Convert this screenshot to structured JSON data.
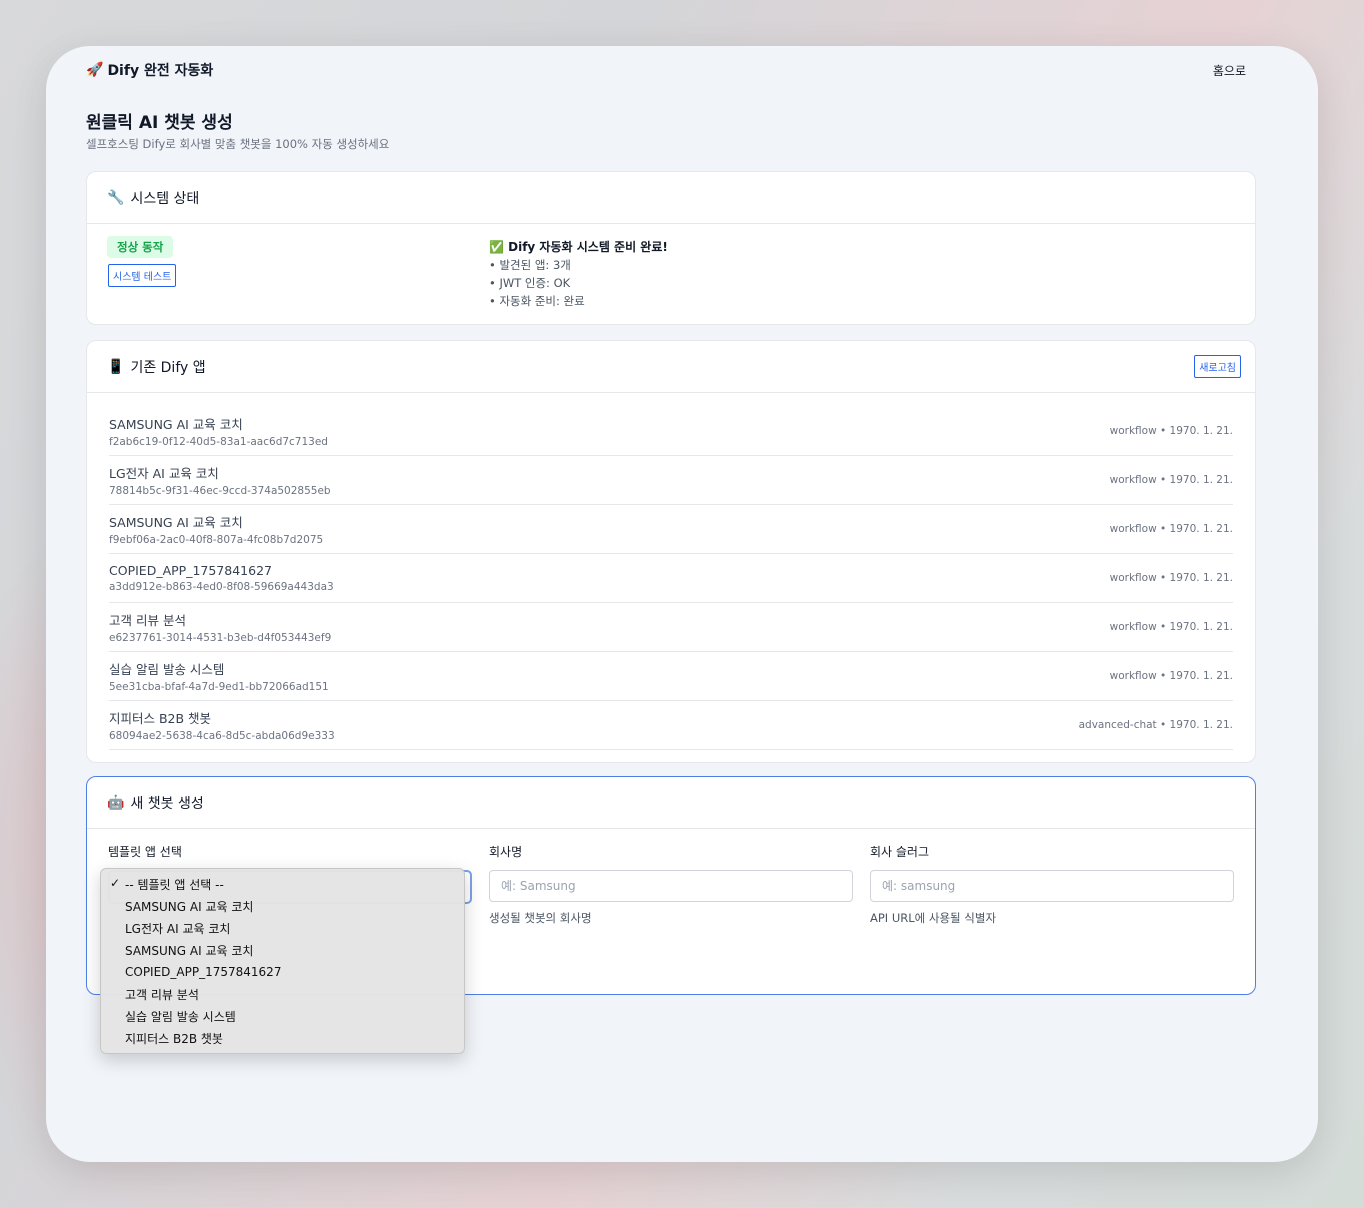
{
  "topbar": {
    "brand_icon": "rocket-icon",
    "brand": "Dify 완전 자동화",
    "home_link": "홈으로"
  },
  "header": {
    "title": "원클릭 AI 챗봇 생성",
    "subtitle": "셀프호스팅 Dify로 회사별 맞춤 챗봇을 100% 자동 생성하세요"
  },
  "system_status": {
    "title": "시스템 상태",
    "icon": "wrench-icon",
    "badge": "정상 동작",
    "test_button": "시스템 테스트",
    "message_lead": "Dify 자동화 시스템 준비 완료!",
    "lines": [
      "• 발견된 앱: 3개",
      "• JWT 인증: OK",
      "• 자동화 준비: 완료"
    ],
    "colors": {
      "ok_bg": "#dcfce7",
      "ok_text": "#16a34a",
      "accent": "#2563eb"
    }
  },
  "apps": {
    "title": "기존 Dify 앱",
    "icon": "phone-icon",
    "refresh_button": "새로고침",
    "items": [
      {
        "name": "SAMSUNG AI 교육 코치",
        "id": "f2ab6c19-0f12-40d5-83a1-aac6d7c713ed",
        "meta": "workflow • 1970. 1. 21."
      },
      {
        "name": "LG전자 AI 교육 코치",
        "id": "78814b5c-9f31-46ec-9ccd-374a502855eb",
        "meta": "workflow • 1970. 1. 21."
      },
      {
        "name": "SAMSUNG AI 교육 코치",
        "id": "f9ebf06a-2ac0-40f8-807a-4fc08b7d2075",
        "meta": "workflow • 1970. 1. 21."
      },
      {
        "name": "COPIED_APP_1757841627",
        "id": "a3dd912e-b863-4ed0-8f08-59669a443da3",
        "meta": "workflow • 1970. 1. 21."
      },
      {
        "name": "고객 리뷰 분석",
        "id": "e6237761-3014-4531-b3eb-d4f053443ef9",
        "meta": "workflow • 1970. 1. 21."
      },
      {
        "name": "실습 알림 발송 시스템",
        "id": "5ee31cba-bfaf-4a7d-9ed1-bb72066ad151",
        "meta": "workflow • 1970. 1. 21."
      },
      {
        "name": "지피터스 B2B 챗봇",
        "id": "68094ae2-5638-4ca6-8d5c-abda06d9e333",
        "meta": "advanced-chat • 1970. 1. 21."
      }
    ]
  },
  "new_chatbot": {
    "title": "새 챗봇 생성",
    "icon": "robot-icon",
    "template_label": "템플릿 앱 선택",
    "company_label": "회사명",
    "company_placeholder": "예: Samsung",
    "company_help": "생성될 챗봇의 회사명",
    "slug_label": "회사 슬러그",
    "slug_placeholder": "예: samsung",
    "slug_help": "API URL에 사용될 식별자"
  },
  "template_dropdown": {
    "selected_index": 0,
    "options": [
      "-- 템플릿 앱 선택 --",
      "SAMSUNG AI 교육 코치",
      "LG전자 AI 교육 코치",
      "SAMSUNG AI 교육 코치",
      "COPIED_APP_1757841627",
      "고객 리뷰 분석",
      "실습 알림 발송 시스템",
      "지피터스 B2B 챗봇"
    ]
  }
}
